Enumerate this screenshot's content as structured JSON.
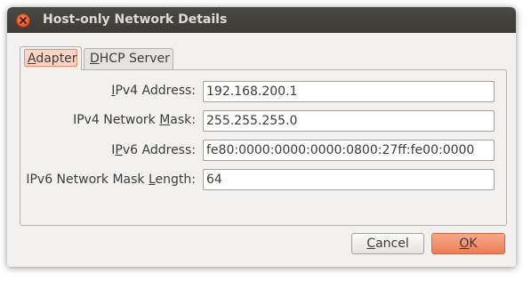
{
  "window": {
    "title": "Host-only Network Details"
  },
  "tabs": [
    {
      "label_accel": "A",
      "label_rest": "dapter",
      "selected": true
    },
    {
      "label_accel": "D",
      "label_rest": "HCP Server",
      "selected": false
    }
  ],
  "fields": [
    {
      "label_pre": "",
      "label_accel": "I",
      "label_post": "Pv4 Address:",
      "value": "192.168.200.1"
    },
    {
      "label_pre": "IPv4 Network ",
      "label_accel": "M",
      "label_post": "ask:",
      "value": "255.255.255.0"
    },
    {
      "label_pre": "I",
      "label_accel": "P",
      "label_post": "v6 Address:",
      "value": "fe80:0000:0000:0000:0800:27ff:fe00:0000"
    },
    {
      "label_pre": "IPv6 Network Mask ",
      "label_accel": "L",
      "label_post": "ength:",
      "value": "64"
    }
  ],
  "buttons": {
    "cancel": {
      "accel": "C",
      "rest": "ancel"
    },
    "ok": {
      "accel": "O",
      "rest": "K"
    }
  },
  "colors": {
    "titlebar": "#3c3b37",
    "close_button": "#e0471a",
    "accent": "#ef7d55",
    "window_bg": "#f2f1f0"
  },
  "icons": {
    "close": "close-icon"
  }
}
